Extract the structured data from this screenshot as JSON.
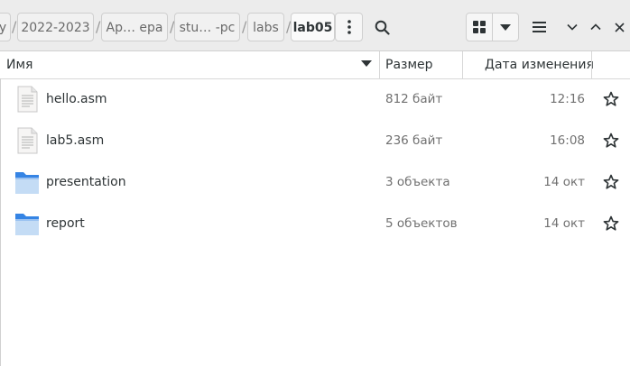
{
  "breadcrumbs": [
    {
      "label": "y"
    },
    {
      "label": "2022-2023"
    },
    {
      "label": "Ар… ера"
    },
    {
      "label": "stu… -pc"
    },
    {
      "label": "labs"
    },
    {
      "label": "lab05"
    }
  ],
  "columns": {
    "name": "Имя",
    "size": "Размер",
    "modified": "Дата изменения"
  },
  "files": [
    {
      "name": "hello.asm",
      "size": "812 байт",
      "modified": "12:16",
      "type": "text-file"
    },
    {
      "name": "lab5.asm",
      "size": "236 байт",
      "modified": "16:08",
      "type": "text-file"
    },
    {
      "name": "presentation",
      "size": "3 объекта",
      "modified": "14 окт",
      "type": "folder"
    },
    {
      "name": "report",
      "size": "5 объектов",
      "modified": "14 окт",
      "type": "folder"
    }
  ],
  "icons": {
    "menu": "more-vertical-icon",
    "search": "search-icon",
    "view": "grid-view-icon",
    "view_options": "chevron-down-icon",
    "main_menu": "hamburger-icon",
    "minimize": "minimize-icon",
    "maximize": "maximize-icon",
    "close": "close-icon",
    "star": "star-icon"
  },
  "colors": {
    "folder": "#4a90d9",
    "header_bg": "#ececec"
  }
}
